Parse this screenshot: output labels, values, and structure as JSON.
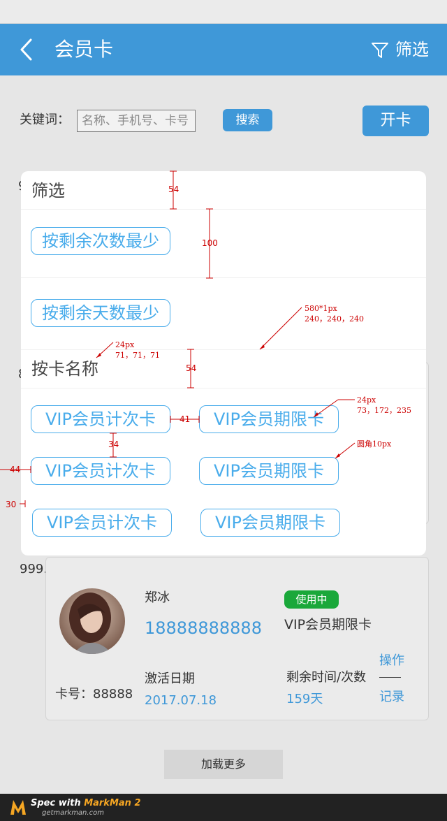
{
  "header": {
    "title": "会员卡",
    "filter_label": "筛选"
  },
  "search": {
    "label": "关键词：",
    "placeholder": "名称、手机号、卡号",
    "button_label": "搜索"
  },
  "open_card_label": "开卡",
  "background_list": {
    "peek_char_top": "9",
    "peek_char_mid": "8",
    "peek_count": "999."
  },
  "member": {
    "name": "郑冰",
    "phone": "18888888888",
    "status": "使用中",
    "card_type": "VIP会员期限卡",
    "activate_label": "激活日期",
    "activate_date": "2017.07.18",
    "remain_label": "剩余时间/次数",
    "remain_value": "159天",
    "card_no": "卡号：88888",
    "op_label": "操作",
    "record_label": "记录"
  },
  "load_more": "加载更多",
  "filter_panel": {
    "title": "筛选",
    "sort_options": [
      "按剩余次数最少",
      "按剩余天数最少"
    ],
    "name_section_title": "按卡名称",
    "card_names": [
      [
        "VIP会员计次卡",
        "VIP会员期限卡"
      ],
      [
        "VIP会员计次卡",
        "VIP会员期限卡"
      ],
      [
        "VIP会员计次卡",
        "VIP会员期限卡"
      ]
    ]
  },
  "annotations": {
    "h54_a": "54",
    "h100": "100",
    "sep_spec_1": "580*1px",
    "sep_spec_2": "240，240，240",
    "title_spec_1": "24px",
    "title_spec_2": "71，71，71",
    "h54_b": "54",
    "chip_spec_1": "24px",
    "chip_spec_2": "73，172，235",
    "gap41": "41",
    "radius_spec": "圆角10px",
    "gap34": "34",
    "left44": "44",
    "left30": "30"
  },
  "markman": {
    "prefix": "Spec with ",
    "brand": "MarkMan 2",
    "url": "getmarkman.com"
  },
  "colors": {
    "primary": "#3f98d8",
    "chip": "#49aceb",
    "status": "#1aa83a",
    "annotation": "#cc0000"
  }
}
